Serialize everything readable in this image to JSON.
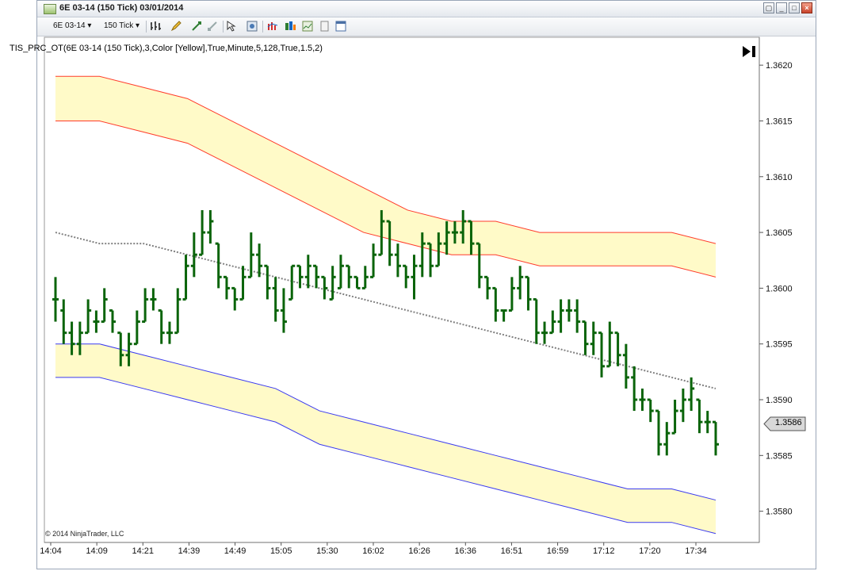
{
  "window": {
    "title": "6E 03-14 (150 Tick)  03/01/2014"
  },
  "toolbar": {
    "instrument": "6E 03-14",
    "interval": "150 Tick",
    "icons": [
      "bar-type-icon",
      "draw-pencil-icon",
      "zoom-in-icon",
      "zoom-out-icon",
      "cursor-icon",
      "properties-icon",
      "indicators-icon",
      "strategies-icon",
      "chart-trader-icon",
      "data-box-icon",
      "window-icon"
    ]
  },
  "indicator_label": "TIS_PRC_OT(6E 03-14 (150 Tick),3,Color [Yellow],True,Minute,5,128,True,1.5,2)",
  "copyright": "© 2014 NinjaTrader, LLC",
  "last_price": "1.3586",
  "colors": {
    "bars": "#0a640a",
    "upper_band_fill": "#fffac8",
    "upper_band_line": "#ff3b2b",
    "lower_band_line": "#3a3af0",
    "midline": "#808080"
  },
  "chart_data": {
    "type": "bar",
    "title": "",
    "xlabel": "",
    "ylabel": "",
    "ylim": [
      1.35772,
      1.36225
    ],
    "y_ticks": [
      "1.3620",
      "1.3615",
      "1.3610",
      "1.3605",
      "1.3600",
      "1.3595",
      "1.3590",
      "1.3585",
      "1.3580"
    ],
    "x_ticks": [
      "14:04",
      "14:09",
      "14:21",
      "14:39",
      "14:49",
      "15:05",
      "15:30",
      "16:02",
      "16:26",
      "16:36",
      "16:51",
      "16:59",
      "17:12",
      "17:20",
      "17:34"
    ],
    "upper_band_top": [
      1.3619,
      1.3619,
      1.3618,
      1.3617,
      1.3615,
      1.3613,
      1.3611,
      1.3609,
      1.3607,
      1.3606,
      1.3606,
      1.3605,
      1.3605,
      1.3605,
      1.3605,
      1.3604
    ],
    "upper_band_bottom": [
      1.3615,
      1.3615,
      1.3614,
      1.3613,
      1.3611,
      1.3609,
      1.3607,
      1.3605,
      1.3604,
      1.3603,
      1.3603,
      1.3602,
      1.3602,
      1.3602,
      1.3602,
      1.3601
    ],
    "midline": [
      1.3605,
      1.3604,
      1.3604,
      1.3603,
      1.3602,
      1.3601,
      1.36,
      1.3599,
      1.3598,
      1.3597,
      1.3596,
      1.3595,
      1.3594,
      1.3593,
      1.3592,
      1.3591
    ],
    "lower_band_top": [
      1.3595,
      1.3595,
      1.3594,
      1.3593,
      1.3592,
      1.3591,
      1.3589,
      1.3588,
      1.3587,
      1.3586,
      1.3585,
      1.3584,
      1.3583,
      1.3582,
      1.3582,
      1.3581
    ],
    "lower_band_bottom": [
      1.3592,
      1.3592,
      1.3591,
      1.359,
      1.3589,
      1.3588,
      1.3586,
      1.3585,
      1.3584,
      1.3583,
      1.3582,
      1.3581,
      1.358,
      1.3579,
      1.3579,
      1.3578
    ],
    "bars": [
      {
        "h": 1.3601,
        "l": 1.3597,
        "o": 1.3599,
        "c": 1.3599
      },
      {
        "h": 1.3599,
        "l": 1.3595,
        "o": 1.3598,
        "c": 1.3596
      },
      {
        "h": 1.3597,
        "l": 1.3594,
        "o": 1.3596,
        "c": 1.3595
      },
      {
        "h": 1.3597,
        "l": 1.3594,
        "o": 1.3595,
        "c": 1.3596
      },
      {
        "h": 1.3599,
        "l": 1.3596,
        "o": 1.3596,
        "c": 1.3598
      },
      {
        "h": 1.3598,
        "l": 1.3596,
        "o": 1.3597,
        "c": 1.3597
      },
      {
        "h": 1.36,
        "l": 1.3597,
        "o": 1.3597,
        "c": 1.3599
      },
      {
        "h": 1.3598,
        "l": 1.3596,
        "o": 1.3598,
        "c": 1.3597
      },
      {
        "h": 1.3596,
        "l": 1.3593,
        "o": 1.3596,
        "c": 1.3594
      },
      {
        "h": 1.3596,
        "l": 1.3593,
        "o": 1.3594,
        "c": 1.3595
      },
      {
        "h": 1.3598,
        "l": 1.3595,
        "o": 1.3595,
        "c": 1.3597
      },
      {
        "h": 1.36,
        "l": 1.3597,
        "o": 1.3597,
        "c": 1.3599
      },
      {
        "h": 1.36,
        "l": 1.3598,
        "o": 1.3599,
        "c": 1.3599
      },
      {
        "h": 1.3598,
        "l": 1.3595,
        "o": 1.3598,
        "c": 1.3596
      },
      {
        "h": 1.3597,
        "l": 1.3595,
        "o": 1.3596,
        "c": 1.3596
      },
      {
        "h": 1.36,
        "l": 1.3596,
        "o": 1.3596,
        "c": 1.3599
      },
      {
        "h": 1.3603,
        "l": 1.3599,
        "o": 1.3599,
        "c": 1.3602
      },
      {
        "h": 1.3605,
        "l": 1.3601,
        "o": 1.3602,
        "c": 1.3603
      },
      {
        "h": 1.3607,
        "l": 1.3603,
        "o": 1.3603,
        "c": 1.3605
      },
      {
        "h": 1.3607,
        "l": 1.3604,
        "o": 1.3605,
        "c": 1.3606
      },
      {
        "h": 1.3604,
        "l": 1.36,
        "o": 1.3604,
        "c": 1.3601
      },
      {
        "h": 1.3601,
        "l": 1.3599,
        "o": 1.3601,
        "c": 1.36
      },
      {
        "h": 1.36,
        "l": 1.3598,
        "o": 1.36,
        "c": 1.3599
      },
      {
        "h": 1.3602,
        "l": 1.3599,
        "o": 1.3599,
        "c": 1.3601
      },
      {
        "h": 1.3605,
        "l": 1.3601,
        "o": 1.3601,
        "c": 1.3603
      },
      {
        "h": 1.3604,
        "l": 1.3601,
        "o": 1.3603,
        "c": 1.3602
      },
      {
        "h": 1.3602,
        "l": 1.3599,
        "o": 1.3602,
        "c": 1.36
      },
      {
        "h": 1.3601,
        "l": 1.3597,
        "o": 1.36,
        "c": 1.3598
      },
      {
        "h": 1.36,
        "l": 1.3596,
        "o": 1.3598,
        "c": 1.3597
      },
      {
        "h": 1.3602,
        "l": 1.3599,
        "o": 1.3599,
        "c": 1.3602
      },
      {
        "h": 1.3602,
        "l": 1.36,
        "o": 1.3602,
        "c": 1.3601
      },
      {
        "h": 1.3603,
        "l": 1.36,
        "o": 1.3601,
        "c": 1.3602
      },
      {
        "h": 1.3602,
        "l": 1.36,
        "o": 1.3602,
        "c": 1.3601
      },
      {
        "h": 1.3601,
        "l": 1.3599,
        "o": 1.3601,
        "c": 1.36
      },
      {
        "h": 1.3602,
        "l": 1.3599,
        "o": 1.3599,
        "c": 1.3601
      },
      {
        "h": 1.3603,
        "l": 1.36,
        "o": 1.36,
        "c": 1.3602
      },
      {
        "h": 1.3602,
        "l": 1.36,
        "o": 1.3602,
        "c": 1.3601
      },
      {
        "h": 1.3601,
        "l": 1.36,
        "o": 1.3601,
        "c": 1.36
      },
      {
        "h": 1.3602,
        "l": 1.36,
        "o": 1.36,
        "c": 1.3601
      },
      {
        "h": 1.3604,
        "l": 1.3601,
        "o": 1.3601,
        "c": 1.3603
      },
      {
        "h": 1.3607,
        "l": 1.3603,
        "o": 1.3603,
        "c": 1.3606
      },
      {
        "h": 1.3606,
        "l": 1.3602,
        "o": 1.3606,
        "c": 1.3603
      },
      {
        "h": 1.3604,
        "l": 1.3601,
        "o": 1.3603,
        "c": 1.3602
      },
      {
        "h": 1.3602,
        "l": 1.36,
        "o": 1.3602,
        "c": 1.3601
      },
      {
        "h": 1.3603,
        "l": 1.3599,
        "o": 1.3601,
        "c": 1.3602
      },
      {
        "h": 1.3605,
        "l": 1.3601,
        "o": 1.3602,
        "c": 1.3604
      },
      {
        "h": 1.3604,
        "l": 1.3601,
        "o": 1.3604,
        "c": 1.3602
      },
      {
        "h": 1.3605,
        "l": 1.3602,
        "o": 1.3602,
        "c": 1.3604
      },
      {
        "h": 1.3606,
        "l": 1.3603,
        "o": 1.3604,
        "c": 1.3605
      },
      {
        "h": 1.3606,
        "l": 1.3604,
        "o": 1.3605,
        "c": 1.3605
      },
      {
        "h": 1.3607,
        "l": 1.3604,
        "o": 1.3605,
        "c": 1.3606
      },
      {
        "h": 1.3606,
        "l": 1.3603,
        "o": 1.3606,
        "c": 1.3604
      },
      {
        "h": 1.3604,
        "l": 1.36,
        "o": 1.3604,
        "c": 1.3601
      },
      {
        "h": 1.3601,
        "l": 1.3599,
        "o": 1.3601,
        "c": 1.36
      },
      {
        "h": 1.36,
        "l": 1.3597,
        "o": 1.36,
        "c": 1.3598
      },
      {
        "h": 1.3598,
        "l": 1.3597,
        "o": 1.3598,
        "c": 1.3598
      },
      {
        "h": 1.3601,
        "l": 1.3598,
        "o": 1.3598,
        "c": 1.36
      },
      {
        "h": 1.3602,
        "l": 1.3599,
        "o": 1.36,
        "c": 1.3601
      },
      {
        "h": 1.3601,
        "l": 1.3598,
        "o": 1.3601,
        "c": 1.3599
      },
      {
        "h": 1.3599,
        "l": 1.3595,
        "o": 1.3599,
        "c": 1.3596
      },
      {
        "h": 1.3597,
        "l": 1.3595,
        "o": 1.3596,
        "c": 1.3596
      },
      {
        "h": 1.3598,
        "l": 1.3596,
        "o": 1.3596,
        "c": 1.3597
      },
      {
        "h": 1.3599,
        "l": 1.3596,
        "o": 1.3597,
        "c": 1.3598
      },
      {
        "h": 1.3599,
        "l": 1.3597,
        "o": 1.3598,
        "c": 1.3598
      },
      {
        "h": 1.3599,
        "l": 1.3596,
        "o": 1.3598,
        "c": 1.3597
      },
      {
        "h": 1.3597,
        "l": 1.3594,
        "o": 1.3597,
        "c": 1.3595
      },
      {
        "h": 1.3597,
        "l": 1.3594,
        "o": 1.3595,
        "c": 1.3596
      },
      {
        "h": 1.3596,
        "l": 1.3592,
        "o": 1.3596,
        "c": 1.3593
      },
      {
        "h": 1.3597,
        "l": 1.3593,
        "o": 1.3593,
        "c": 1.3596
      },
      {
        "h": 1.3596,
        "l": 1.3593,
        "o": 1.3596,
        "c": 1.3594
      },
      {
        "h": 1.3595,
        "l": 1.3591,
        "o": 1.3594,
        "c": 1.3592
      },
      {
        "h": 1.3593,
        "l": 1.3589,
        "o": 1.3592,
        "c": 1.359
      },
      {
        "h": 1.3591,
        "l": 1.3589,
        "o": 1.359,
        "c": 1.359
      },
      {
        "h": 1.359,
        "l": 1.3588,
        "o": 1.359,
        "c": 1.3589
      },
      {
        "h": 1.3589,
        "l": 1.3585,
        "o": 1.3589,
        "c": 1.3586
      },
      {
        "h": 1.3588,
        "l": 1.3585,
        "o": 1.3586,
        "c": 1.3587
      },
      {
        "h": 1.359,
        "l": 1.3587,
        "o": 1.3587,
        "c": 1.3589
      },
      {
        "h": 1.3591,
        "l": 1.3588,
        "o": 1.3589,
        "c": 1.359
      },
      {
        "h": 1.3592,
        "l": 1.3589,
        "o": 1.359,
        "c": 1.3591
      },
      {
        "h": 1.359,
        "l": 1.3587,
        "o": 1.359,
        "c": 1.3588
      },
      {
        "h": 1.3589,
        "l": 1.3587,
        "o": 1.3588,
        "c": 1.3588
      },
      {
        "h": 1.3588,
        "l": 1.3585,
        "o": 1.3588,
        "c": 1.3586
      }
    ]
  }
}
